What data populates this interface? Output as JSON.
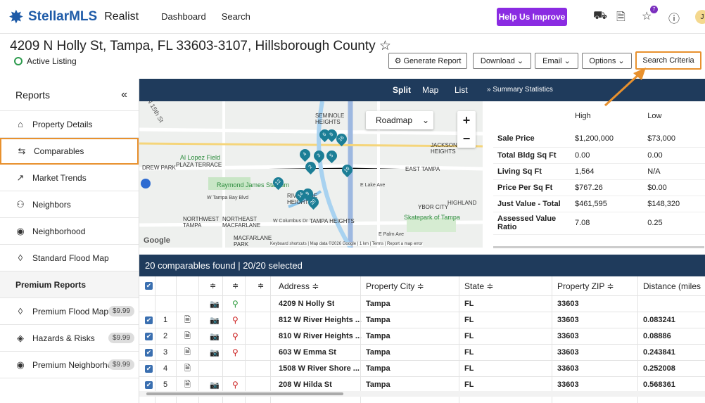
{
  "header": {
    "brand": "StellarMLS",
    "product": "Realist",
    "nav": [
      "Dashboard",
      "Search"
    ],
    "help_label": "Help Us Improve",
    "notification_count": "7",
    "avatar_initial": "J"
  },
  "property": {
    "address": "4209 N Holly St, Tampa, FL 33603-3107, Hillsborough County ☆",
    "status": "Active Listing"
  },
  "actions": {
    "generate": "⚙ Generate Report",
    "download": "Download ⌄",
    "email": "Email ⌄",
    "options": "Options ⌄",
    "search_criteria": "Search Criteria"
  },
  "sidebar": {
    "title": "Reports",
    "collapse": "«",
    "items": [
      {
        "label": "Property Details",
        "icon": "⌂"
      },
      {
        "label": "Comparables",
        "icon": "⇆"
      },
      {
        "label": "Market Trends",
        "icon": "↗"
      },
      {
        "label": "Neighbors",
        "icon": "⚇"
      },
      {
        "label": "Neighborhood",
        "icon": "◉"
      },
      {
        "label": "Standard Flood Map",
        "icon": "◊"
      }
    ],
    "premium_title": "Premium Reports",
    "premium": [
      {
        "label": "Premium Flood Map",
        "price": "$9.99",
        "icon": "◊"
      },
      {
        "label": "Hazards & Risks",
        "price": "$9.99",
        "icon": "◈"
      },
      {
        "label": "Premium Neighborho...",
        "price": "$9.99",
        "icon": "◉"
      }
    ]
  },
  "mapbar": {
    "split": "Split",
    "map": "Map",
    "list": "List",
    "summary": "» Summary Statistics"
  },
  "map": {
    "type": "Roadmap",
    "attribution": "Keyboard shortcuts | Map data ©2026 Google | 1 km | Terms | Report a map error",
    "labels": [
      "SEMINOLE HEIGHTS",
      "JACKSON HEIGHTS",
      "DREW PARK",
      "Al Lopez Field",
      "PLAZA TERRACE",
      "Raymond James Stadium",
      "W Tampa Bay Blvd",
      "RIVERSIDE HEIGHTS",
      "NORTHWEST TAMPA",
      "NORTHEAST MACFARLANE",
      "MACFARLANE PARK",
      "W Columbus Dr",
      "TAMPA HEIGHTS",
      "EAST TAMPA",
      "YBOR CITY",
      "Skatepark of Tampa",
      "HIGHLAND",
      "E Lake Ave",
      "E Palm Ave",
      "N 15th St",
      "Google"
    ],
    "markers": [
      "6",
      "8",
      "16",
      "4",
      "3",
      "5",
      "19",
      "2",
      "13",
      "14",
      "9",
      "20"
    ]
  },
  "stats": {
    "col_high": "High",
    "col_low": "Low",
    "rows": [
      {
        "label": "Sale Price",
        "high": "$1,200,000",
        "low": "$73,000"
      },
      {
        "label": "Total Bldg Sq Ft",
        "high": "0.00",
        "low": "0.00"
      },
      {
        "label": "Living Sq Ft",
        "high": "1,564",
        "low": "N/A"
      },
      {
        "label": "Price Per Sq Ft",
        "high": "$767.26",
        "low": "$0.00"
      },
      {
        "label": "Just Value - Total",
        "high": "$461,595",
        "low": "$148,320"
      },
      {
        "label": "Assessed Value Ratio",
        "high": "7.08",
        "low": "0.25"
      }
    ]
  },
  "comps": {
    "summary": "20 comparables found  |  20/20 selected",
    "headers": {
      "address": "Address ≑",
      "city": "Property City ≑",
      "state": "State ≑",
      "zip": "Property ZIP ≑",
      "distance": "Distance (miles"
    },
    "sort_glyph": "≑",
    "subject": {
      "address": "4209 N Holly St",
      "city": "Tampa",
      "state": "FL",
      "zip": "33603",
      "distance": ""
    },
    "rows": [
      {
        "num": "1",
        "address": "812 W River Heights ...",
        "city": "Tampa",
        "state": "FL",
        "zip": "33603",
        "distance": "0.083241"
      },
      {
        "num": "2",
        "address": "810 W River Heights ...",
        "city": "Tampa",
        "state": "FL",
        "zip": "33603",
        "distance": "0.08886"
      },
      {
        "num": "3",
        "address": "603 W Emma St",
        "city": "Tampa",
        "state": "FL",
        "zip": "33603",
        "distance": "0.243841"
      },
      {
        "num": "4",
        "address": "1508 W River Shore ...",
        "city": "Tampa",
        "state": "FL",
        "zip": "33603",
        "distance": "0.252008"
      },
      {
        "num": "5",
        "address": "208 W Hilda St",
        "city": "Tampa",
        "state": "FL",
        "zip": "33603",
        "distance": "0.568361"
      }
    ]
  }
}
